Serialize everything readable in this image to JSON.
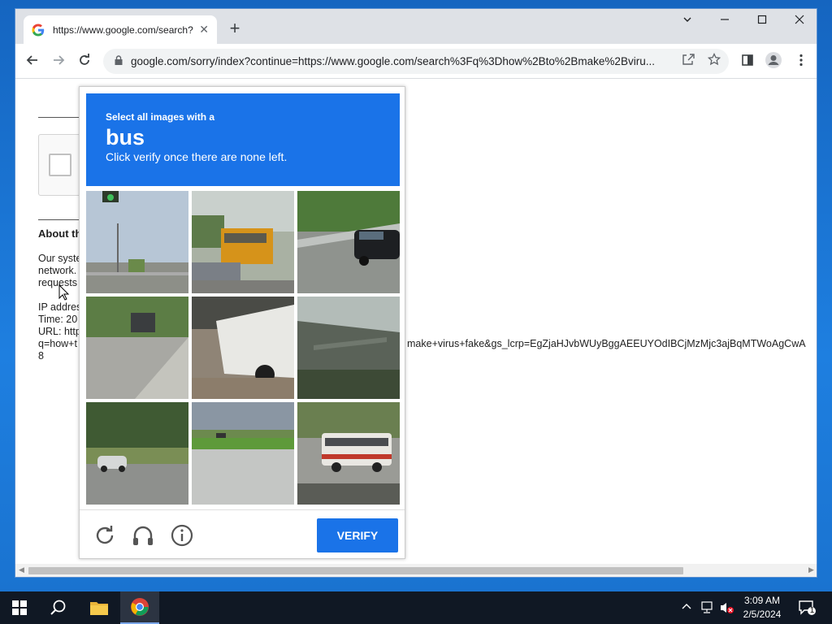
{
  "browser": {
    "tab_title": "https://www.google.com/search?",
    "tab_favicon": "G",
    "url": "google.com/sorry/index?continue=https://www.google.com/search%3Fq%3Dhow%2Bto%2Bmake%2Bviru..."
  },
  "page": {
    "about_heading": "About th",
    "para_lines": [
      "Our syste",
      "network.",
      "requests"
    ],
    "ip_lines": [
      "IP addres",
      "Time: 20",
      "URL: http",
      "q=how+t",
      "8"
    ],
    "url_tail": "make+virus+fake&gs_lcrp=EgZjaHJvbWUyBggAEEUYOdIBCjMzMjc3ajBqMTWoAgCwA"
  },
  "captcha": {
    "instruction_small": "Select all images with a",
    "target": "bus",
    "instruction_sub": "Click verify once there are none left.",
    "verify_label": "VERIFY",
    "tiles": [
      "traffic-light-and-street",
      "school-bus-in-traffic",
      "car-on-highway",
      "road-with-cars",
      "white-bus-side",
      "overpass-bridge",
      "car-near-trees",
      "empty-highway",
      "white-bus-on-road"
    ]
  },
  "taskbar": {
    "time": "3:09 AM",
    "date": "2/5/2024",
    "notification_count": "1"
  },
  "colors": {
    "captcha_blue": "#1a73e8",
    "desktop_blue": "#1565c0",
    "taskbar": "#101824"
  }
}
